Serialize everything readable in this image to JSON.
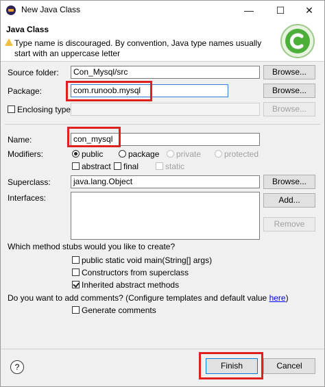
{
  "window": {
    "title": "New Java Class",
    "minimize": "—",
    "maximize": "☐",
    "close": "✕"
  },
  "header": {
    "title": "Java Class",
    "warning": "Type name is discouraged. By convention, Java type names usually start with an uppercase letter"
  },
  "source_folder": {
    "label": "Source folder:",
    "value": "Con_Mysql/src",
    "button": "Browse..."
  },
  "package": {
    "label": "Package:",
    "value": "com.runoob.mysql",
    "button": "Browse..."
  },
  "enclosing": {
    "label": "Enclosing type:",
    "value": "",
    "button": "Browse...",
    "checked": false
  },
  "name": {
    "label": "Name:",
    "value": "con_mysql"
  },
  "modifiers": {
    "label": "Modifiers:",
    "public": "public",
    "package": "package",
    "private": "private",
    "protected": "protected",
    "abstract": "abstract",
    "final": "final",
    "static": "static",
    "selected": "public"
  },
  "superclass": {
    "label": "Superclass:",
    "value": "java.lang.Object",
    "button": "Browse..."
  },
  "interfaces": {
    "label": "Interfaces:",
    "add_button": "Add...",
    "remove_button": "Remove"
  },
  "stubs": {
    "question": "Which method stubs would you like to create?",
    "main": "public static void main(String[] args)",
    "constructors": "Constructors from superclass",
    "inherited": "Inherited abstract methods",
    "main_checked": false,
    "constructors_checked": false,
    "inherited_checked": true
  },
  "comments": {
    "question_pre": "Do you want to add comments? (Configure templates and default value ",
    "link": "here",
    "question_post": ")",
    "generate": "Generate comments",
    "checked": false
  },
  "footer": {
    "help": "?",
    "finish": "Finish",
    "cancel": "Cancel"
  },
  "colors": {
    "highlight": "#e02020",
    "banner_green": "#4caf3a"
  }
}
